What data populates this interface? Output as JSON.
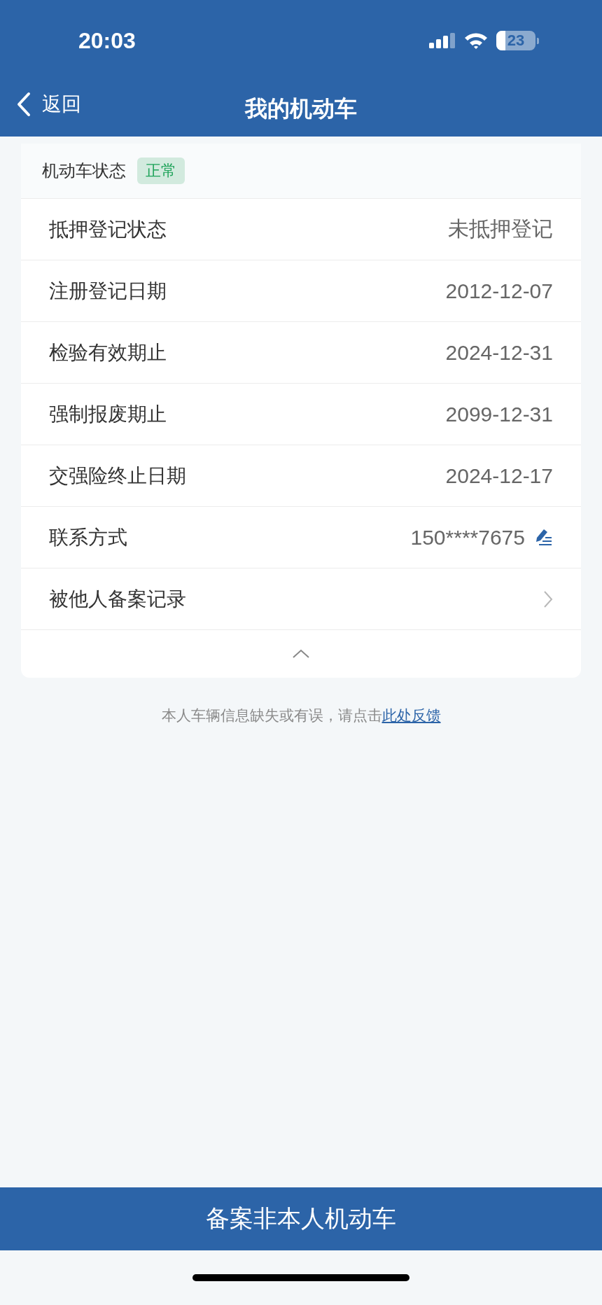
{
  "status_bar": {
    "time": "20:03",
    "battery": "23"
  },
  "nav": {
    "back": "返回",
    "title": "我的机动车"
  },
  "vehicle_status": {
    "label": "机动车状态",
    "badge": "正常",
    "color": "#1fa35a"
  },
  "rows": [
    {
      "kind": "value",
      "label": "抵押登记状态",
      "value": "未抵押登记"
    },
    {
      "kind": "value",
      "label": "注册登记日期",
      "value": "2012-12-07"
    },
    {
      "kind": "value",
      "label": "检验有效期止",
      "value": "2024-12-31"
    },
    {
      "kind": "value",
      "label": "强制报废期止",
      "value": "2099-12-31"
    },
    {
      "kind": "value",
      "label": "交强险终止日期",
      "value": "2024-12-17"
    },
    {
      "kind": "edit",
      "label": "联系方式",
      "value": "150****7675"
    },
    {
      "kind": "link",
      "label": "被他人备案记录"
    }
  ],
  "feedback": {
    "text": "本人车辆信息缺失或有误，请点击",
    "link": "此处反馈"
  },
  "bottom_button": "备案非本人机动车"
}
